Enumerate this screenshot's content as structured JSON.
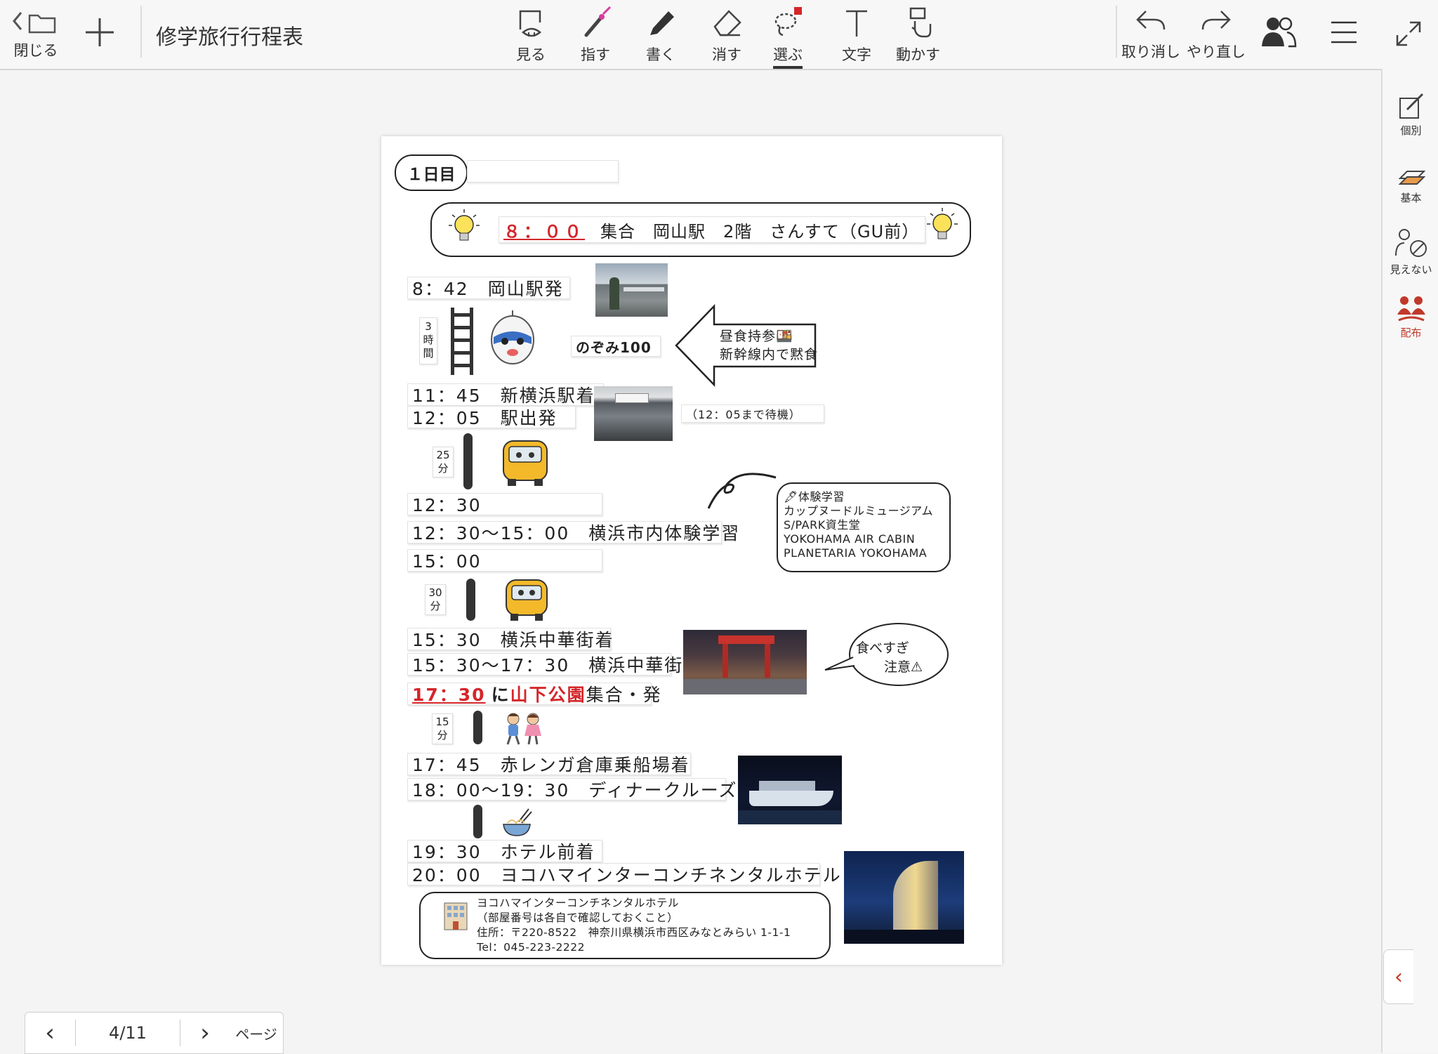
{
  "toolbar": {
    "close_label": "閉じる",
    "title": "修学旅行行程表",
    "tools": [
      {
        "label": "見る",
        "icon": "view-icon"
      },
      {
        "label": "指す",
        "icon": "pointer-icon"
      },
      {
        "label": "書く",
        "icon": "pen-icon"
      },
      {
        "label": "消す",
        "icon": "eraser-icon"
      },
      {
        "label": "選ぶ",
        "icon": "lasso-icon"
      },
      {
        "label": "文字",
        "icon": "text-icon"
      },
      {
        "label": "動かす",
        "icon": "move-icon"
      }
    ],
    "undo_label": "取り消し",
    "redo_label": "やり直し"
  },
  "rail": {
    "items": [
      {
        "label": "個別",
        "icon": "individual-icon"
      },
      {
        "label": "基本",
        "icon": "layers-icon"
      },
      {
        "label": "見えない",
        "icon": "hidden-icon"
      },
      {
        "label": "配布",
        "icon": "distribute-icon"
      }
    ]
  },
  "colors": {
    "accent_red": "#d4262b",
    "rail_red": "#c0392b"
  },
  "document": {
    "day_label": "１日目",
    "meet": {
      "time": "８：００",
      "text": "集合　岡山駅　2階　さんすて（GU前）"
    },
    "l_okayama": "8：42　岡山駅発",
    "d_3h": [
      "3",
      "時",
      "間"
    ],
    "train_name": "のぞみ100",
    "lunch": [
      "昼食持参🍱",
      "新幹線内で黙食"
    ],
    "l_shinyoko_1": "11：45　新横浜駅着",
    "l_shinyoko_2": "12：05　駅出発",
    "wait_note": "（12：05まで待機）",
    "d_25": [
      "25",
      "分"
    ],
    "l_1230": "12：30",
    "l_taiken": "12：30～15：00　横浜市内体験学習",
    "taiken_box": [
      "🖋体験学習",
      "カップヌードルミュージアム",
      "S/PARK資生堂",
      "YOKOHAMA AIR CABIN",
      "PLANETARIA YOKOHAMA"
    ],
    "l_1500": "15：00",
    "d_30": [
      "30",
      "分"
    ],
    "l_chuka_1": "15：30　横浜中華街着",
    "l_chuka_2": "15：30～17：30　横浜中華街",
    "gather": {
      "time": "17：30",
      "ni": "に",
      "place": "山下公園",
      "rest": "集合・発"
    },
    "tabesugi": [
      "食べすぎ",
      "注意⚠"
    ],
    "d_15": [
      "15",
      "分"
    ],
    "l_akarenga": "17：45　赤レンガ倉庫乗船場着",
    "l_cruise": "18：00～19：30　ディナークルーズ",
    "l_hotel_1": "19：30　ホテル前着",
    "l_hotel_2": "20：00　ヨコハマインターコンチネンタルホテル",
    "hotel_info": [
      "ヨコハマインターコンチネンタルホテル",
      "（部屋番号は各自で確認しておくこと）",
      "住所：〒220-8522　神奈川県横浜市西区みなとみらい 1-1-1",
      "Tel：045-223-2222"
    ]
  },
  "pager": {
    "page": "4/11",
    "label": "ページ"
  }
}
